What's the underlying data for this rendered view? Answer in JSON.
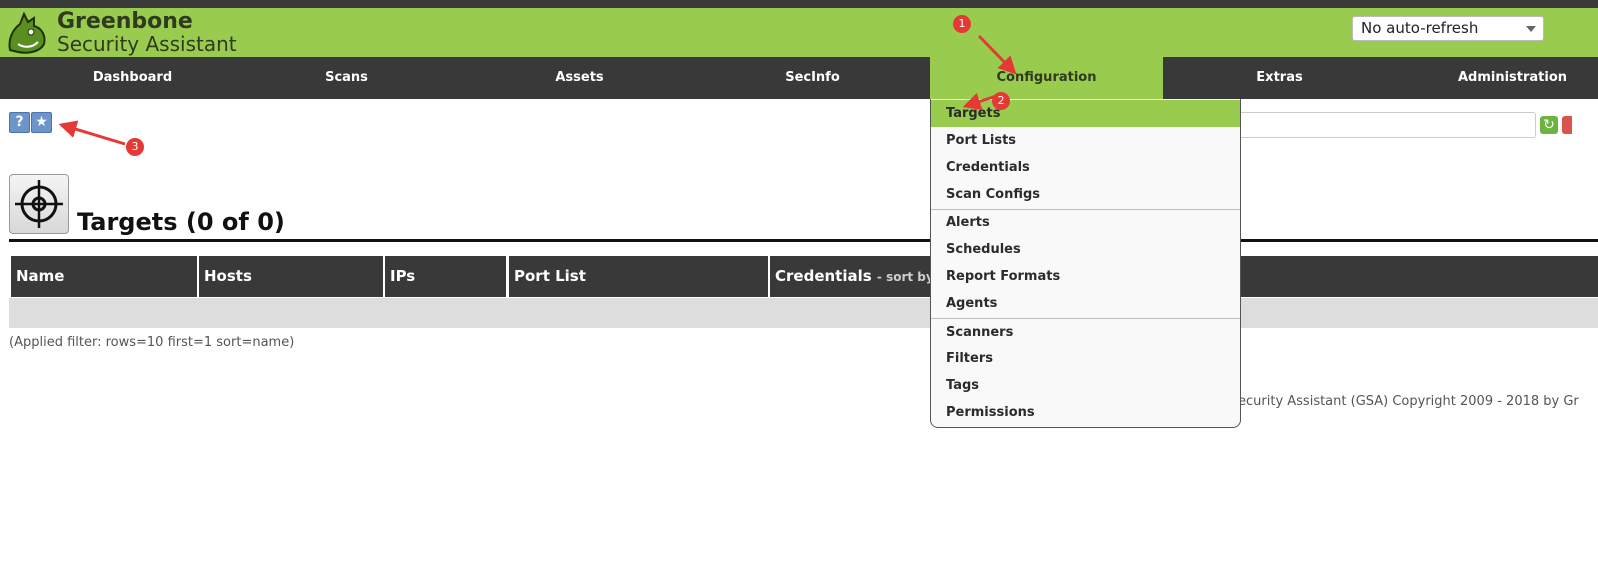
{
  "brand": {
    "line1": "Greenbone",
    "line2": "Security Assistant"
  },
  "refresh": {
    "selected": "No auto-refresh"
  },
  "nav": {
    "items": [
      {
        "label": "Dashboard"
      },
      {
        "label": "Scans"
      },
      {
        "label": "Assets"
      },
      {
        "label": "SecInfo"
      },
      {
        "label": "Configuration"
      },
      {
        "label": "Extras"
      },
      {
        "label": "Administration"
      }
    ],
    "active": "Configuration"
  },
  "toolbar": {
    "help_icon": "?",
    "new_icon": "★"
  },
  "page": {
    "title": "Targets (0 of 0)"
  },
  "table": {
    "headers": [
      "Name",
      "Hosts",
      "IPs",
      "Port List",
      "Credentials"
    ],
    "sort_hint": "- sort by:"
  },
  "filter_text": "(Applied filter: rows=10 first=1 sort=name)",
  "footer_text": "ecurity Assistant (GSA) Copyright 2009 - 2018 by Gr",
  "dropdown": {
    "items": [
      {
        "label": "Targets"
      },
      {
        "label": "Port Lists"
      },
      {
        "label": "Credentials"
      },
      {
        "label": "Scan Configs"
      },
      {
        "label": "Alerts"
      },
      {
        "label": "Schedules"
      },
      {
        "label": "Report Formats"
      },
      {
        "label": "Agents"
      },
      {
        "label": "Scanners"
      },
      {
        "label": "Filters"
      },
      {
        "label": "Tags"
      },
      {
        "label": "Permissions"
      }
    ],
    "active": "Targets"
  },
  "annotations": {
    "m1": "1",
    "m2": "2",
    "m3": "3"
  },
  "colors": {
    "brand_green": "#99cc4e",
    "nav_dark": "#393939",
    "marker_red": "#e53935"
  }
}
